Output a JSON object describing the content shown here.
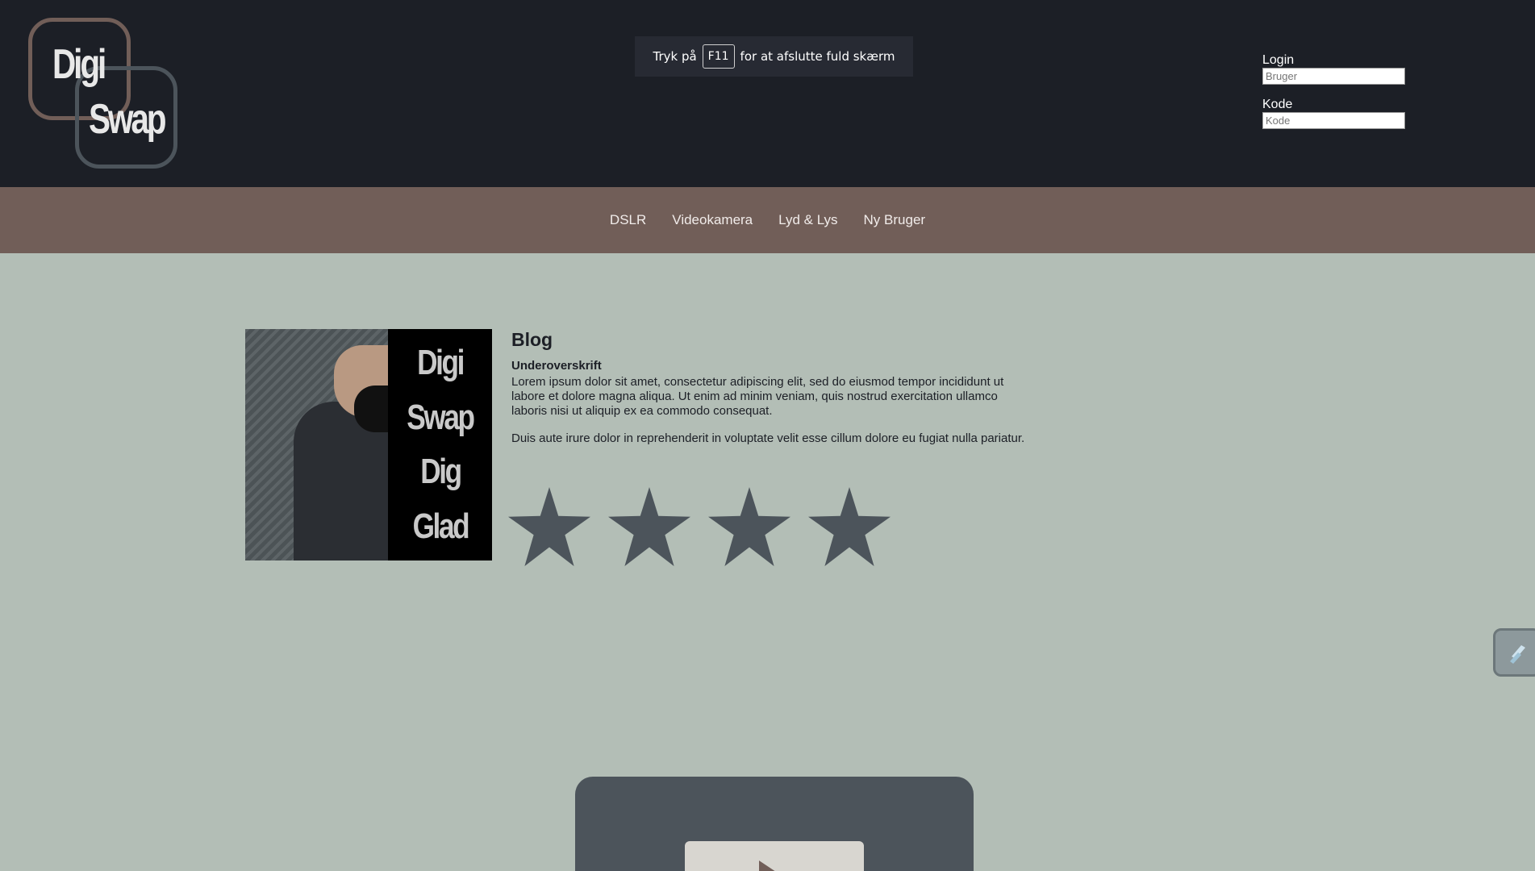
{
  "logo": {
    "line1": "Digi",
    "line2": "Swap"
  },
  "fullscreen_banner": {
    "prefix": "Tryk på",
    "key": "F11",
    "suffix": "for at afslutte fuld skærm"
  },
  "login": {
    "user_label": "Login",
    "user_placeholder": "Bruger",
    "pass_label": "Kode",
    "pass_placeholder": "Kode"
  },
  "nav": {
    "items": [
      {
        "label": "DSLR"
      },
      {
        "label": "Videokamera"
      },
      {
        "label": "Lyd & Lys"
      },
      {
        "label": "Ny Bruger"
      }
    ]
  },
  "blog": {
    "image_words": [
      "Digi",
      "Swap",
      "Dig",
      "Glad"
    ],
    "title": "Blog",
    "subtitle": "Underoverskrift",
    "paragraph1": "Lorem ipsum dolor sit amet, consectetur adipiscing elit, sed do eiusmod tempor incididunt ut labore et dolore magna aliqua. Ut enim ad minim veniam, quis nostrud exercitation ullamco laboris nisi ut aliquip ex ea commodo consequat.",
    "paragraph2": "Duis aute irure dolor in reprehenderit in voluptate velit esse cillum dolore eu fugiat nulla pariatur.",
    "rating": 4,
    "star_color": "#4c545b"
  },
  "colors": {
    "header_bg": "#1c1f26",
    "nav_bg": "#715e58",
    "page_bg": "#b3beb6",
    "card_bg": "#4c545b"
  },
  "icons": {
    "side_button": "sidebar-toggle-icon",
    "video": "play-icon"
  }
}
